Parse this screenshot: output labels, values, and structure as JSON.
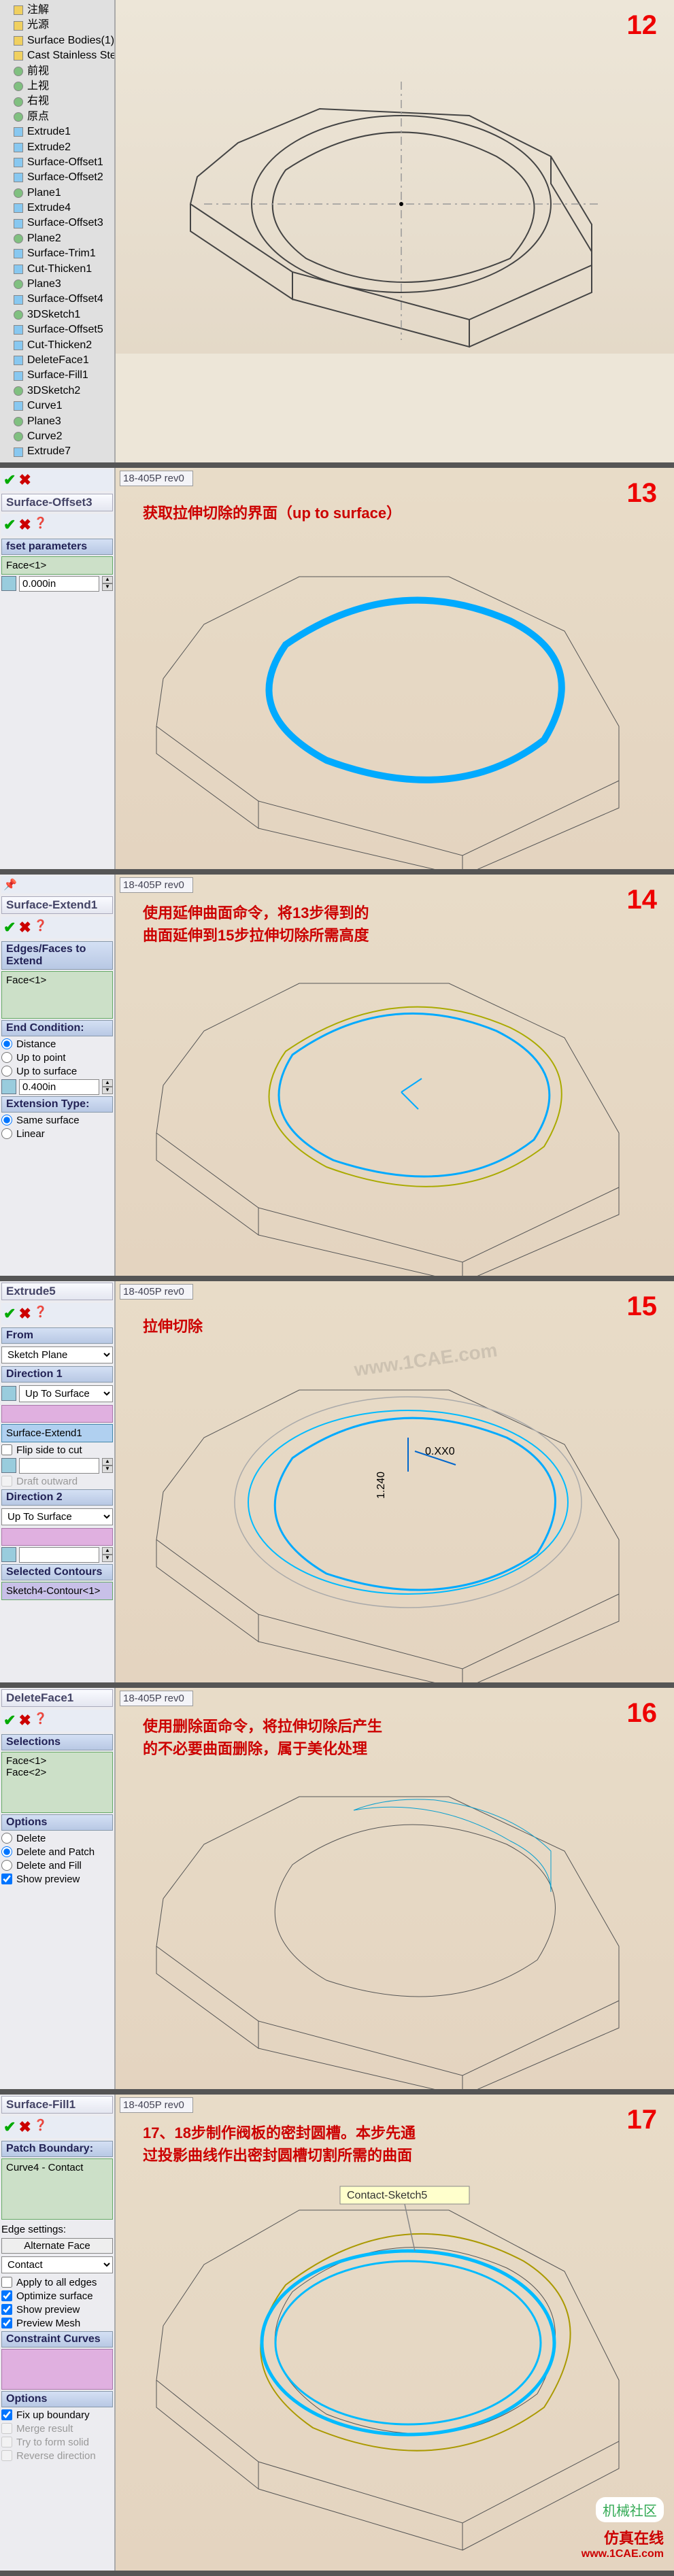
{
  "steps": {
    "n12": "12",
    "n13": "13",
    "n14": "14",
    "n15": "15",
    "n16": "16",
    "n17": "17"
  },
  "tab": "18-405P rev0",
  "feature_tree": {
    "items": [
      {
        "t": "g",
        "l": "注解"
      },
      {
        "t": "g",
        "l": "光源"
      },
      {
        "t": "g",
        "l": "Surface Bodies(1)"
      },
      {
        "t": "g",
        "l": "Cast Stainless Steel"
      },
      {
        "t": "c",
        "l": "前视"
      },
      {
        "t": "c",
        "l": "上视"
      },
      {
        "t": "c",
        "l": "右视"
      },
      {
        "t": "c",
        "l": "原点"
      },
      {
        "t": "b",
        "l": "Extrude1"
      },
      {
        "t": "b",
        "l": "Extrude2"
      },
      {
        "t": "b",
        "l": "Surface-Offset1"
      },
      {
        "t": "b",
        "l": "Surface-Offset2"
      },
      {
        "t": "c",
        "l": "Plane1"
      },
      {
        "t": "b",
        "l": "Extrude4"
      },
      {
        "t": "b",
        "l": "Surface-Offset3"
      },
      {
        "t": "c",
        "l": "Plane2"
      },
      {
        "t": "b",
        "l": "Surface-Trim1"
      },
      {
        "t": "b",
        "l": "Cut-Thicken1"
      },
      {
        "t": "c",
        "l": "Plane3"
      },
      {
        "t": "b",
        "l": "Surface-Offset4"
      },
      {
        "t": "c",
        "l": "3DSketch1"
      },
      {
        "t": "b",
        "l": "Surface-Offset5"
      },
      {
        "t": "b",
        "l": "Cut-Thicken2"
      },
      {
        "t": "b",
        "l": "DeleteFace1"
      },
      {
        "t": "b",
        "l": "Surface-Fill1"
      },
      {
        "t": "c",
        "l": "3DSketch2"
      },
      {
        "t": "b",
        "l": "Curve1"
      },
      {
        "t": "c",
        "l": "Plane3"
      },
      {
        "t": "c",
        "l": "Curve2"
      },
      {
        "t": "b",
        "l": "Extrude7"
      }
    ]
  },
  "p13": {
    "title": "Surface-Offset3",
    "g1": "fset parameters",
    "face": "Face<1>",
    "val": "0.000in",
    "ann": "获取拉伸切除的界面（up to surface）"
  },
  "p14": {
    "title": "Surface-Extend1",
    "g1": "Edges/Faces to Extend",
    "face": "Face<1>",
    "g2": "End Condition:",
    "r1": "Distance",
    "r2": "Up to point",
    "r3": "Up to surface",
    "val": "0.400in",
    "g3": "Extension Type:",
    "r4": "Same surface",
    "r5": "Linear",
    "ann1": "使用延伸曲面命令，将13步得到的",
    "ann2": "曲面延伸到15步拉伸切除所需高度"
  },
  "p15": {
    "title": "Extrude5",
    "from": "From",
    "fv": "Sketch Plane",
    "d1": "Direction 1",
    "u1": "Up To Surface",
    "sf": "Surface-Extend1",
    "flip": "Flip side to cut",
    "draft": "Draft outward",
    "d2": "Direction 2",
    "u2": "Up To Surface",
    "sc": "Selected Contours",
    "sci": "Sketch4-Contour<1>",
    "ann": "拉伸切除",
    "dim1": "0.XX0",
    "dim2": "1.240"
  },
  "p16": {
    "title": "DeleteFace1",
    "g1": "Selections",
    "f1": "Face<1>",
    "f2": "Face<2>",
    "g2": "Options",
    "o1": "Delete",
    "o2": "Delete and Patch",
    "o3": "Delete and Fill",
    "o4": "Show preview",
    "ann1": "使用删除面命令，将拉伸切除后产生",
    "ann2": "的不必要曲面删除，属于美化处理"
  },
  "p17": {
    "title": "Surface-Fill1",
    "g1": "Patch Boundary:",
    "b1": "Curve4 - Contact",
    "g2": "Edge settings:",
    "af": "Alternate Face",
    "cc": "Contact",
    "c1": "Apply to all edges",
    "c2": "Optimize surface",
    "c3": "Show preview",
    "c4": "Preview Mesh",
    "g3": "Constraint Curves",
    "g4": "Options",
    "o1": "Fix up boundary",
    "o2": "Merge result",
    "o3": "Try to form solid",
    "o4": "Reverse direction",
    "ann1": "17、18步制作阀板的密封圆槽。本步先通",
    "ann2": "过投影曲线作出密封圆槽切割所需的曲面",
    "cb": "Contact-Sketch5"
  },
  "wm": {
    "t": "机械社区",
    "u": "www.1CAE.com",
    "s": "仿真在线"
  }
}
